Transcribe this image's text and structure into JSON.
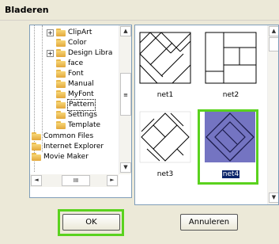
{
  "window": {
    "title": "Bladeren"
  },
  "tree": {
    "items": [
      {
        "label": "ClipArt",
        "expandable": true,
        "expander": "+"
      },
      {
        "label": "Color",
        "expandable": false
      },
      {
        "label": "Design Libra",
        "expandable": true,
        "expander": "+"
      },
      {
        "label": "face",
        "expandable": false
      },
      {
        "label": "Font",
        "expandable": false
      },
      {
        "label": "Manual",
        "expandable": false
      },
      {
        "label": "MyFont",
        "expandable": false
      },
      {
        "label": "Pattern",
        "expandable": false,
        "selected": true
      },
      {
        "label": "Settings",
        "expandable": false
      },
      {
        "label": "Template",
        "expandable": false
      },
      {
        "label": "Common Files",
        "expandable": false
      },
      {
        "label": "Internet Explorer",
        "expandable": false
      },
      {
        "label": "Movie Maker",
        "expandable": false
      }
    ],
    "scroll_up": "▲",
    "scroll_down": "▼",
    "scroll_left": "◄",
    "scroll_right": "►",
    "hthumb_grip": "III",
    "vthumb_grip": "≡"
  },
  "thumbnails": {
    "items": [
      {
        "label": "net1",
        "selected": false
      },
      {
        "label": "net2",
        "selected": false
      },
      {
        "label": "net3",
        "selected": false
      },
      {
        "label": "net4",
        "selected": true
      }
    ],
    "scroll_up": "▲",
    "scroll_down": "▼"
  },
  "buttons": {
    "ok_label": "OK",
    "cancel_label": "Annuleren"
  },
  "colors": {
    "highlight": "#5ad21e",
    "selected_thumb_bg": "#7474c2",
    "selection_text_bg": "#0a246a"
  }
}
